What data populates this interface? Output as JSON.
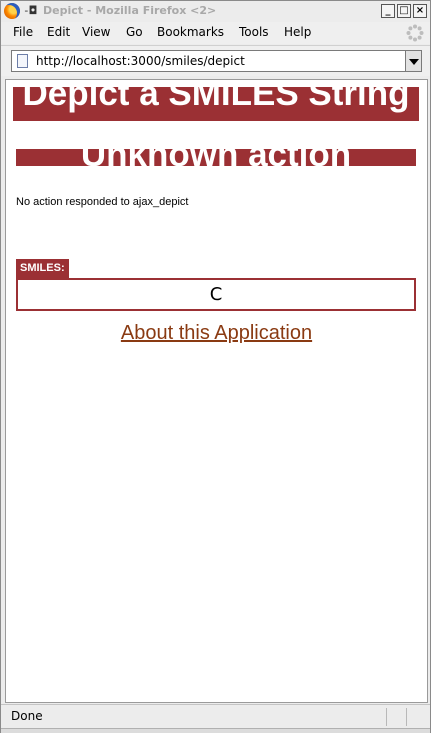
{
  "window": {
    "title": "Depict - Mozilla Firefox <2>",
    "controls": {
      "minimize": "_",
      "maximize": "□",
      "close": "×"
    }
  },
  "menu": [
    "File",
    "Edit",
    "View",
    "Go",
    "Bookmarks",
    "Tools",
    "Help"
  ],
  "address_bar": {
    "url": "http://localhost:3000/smiles/depict"
  },
  "page": {
    "heading": "Depict a SMILES String",
    "error_heading": "Unknown action",
    "message": "No action responded to ajax_depict",
    "smiles_label": "SMILES:",
    "smiles_value": "C",
    "about_link": "About this Application"
  },
  "status": {
    "text": "Done"
  },
  "colors": {
    "banner": "#9b3034",
    "link": "#8a3a12"
  },
  "icons": {
    "app": "firefox-icon",
    "pin": "pin-icon",
    "page": "page-icon",
    "throbber": "throbber-icon"
  }
}
